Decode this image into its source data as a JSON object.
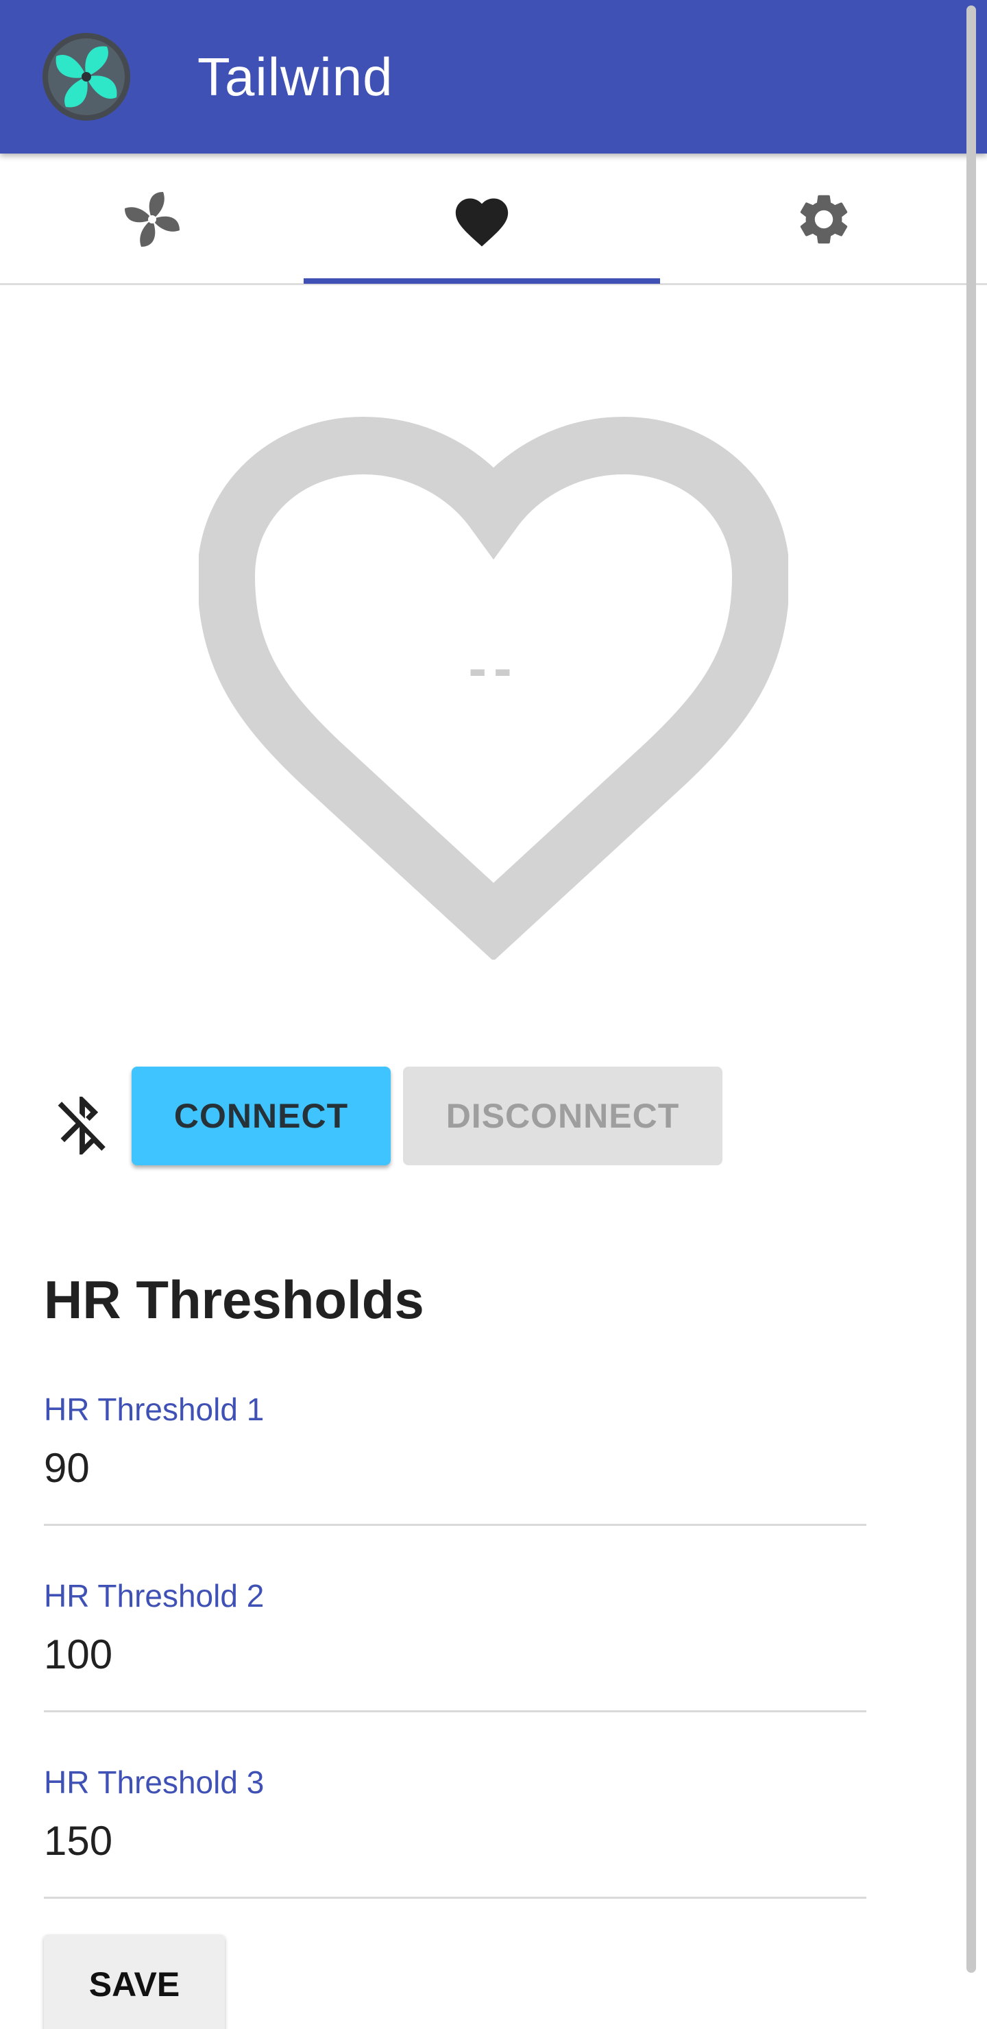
{
  "app": {
    "title": "Tailwind",
    "logo_icon": "fan-logo-icon",
    "brand_color": "#3F51B5"
  },
  "tabs": [
    {
      "icon": "fan-icon",
      "selected": false
    },
    {
      "icon": "heart-icon",
      "selected": true
    },
    {
      "icon": "gear-icon",
      "selected": false
    }
  ],
  "heart_rate": {
    "value": "--",
    "icon": "heart-outline-icon"
  },
  "bluetooth": {
    "icon": "bluetooth-disabled-icon"
  },
  "buttons": {
    "connect": "CONNECT",
    "disconnect": "DISCONNECT",
    "save": "SAVE"
  },
  "colors": {
    "accent": "#40C4FF",
    "disabled": "#e0e0e0"
  },
  "thresholds": {
    "title": "HR Thresholds",
    "fields": [
      {
        "label": "HR Threshold 1",
        "value": "90"
      },
      {
        "label": "HR Threshold 2",
        "value": "100"
      },
      {
        "label": "HR Threshold 3",
        "value": "150"
      }
    ]
  }
}
